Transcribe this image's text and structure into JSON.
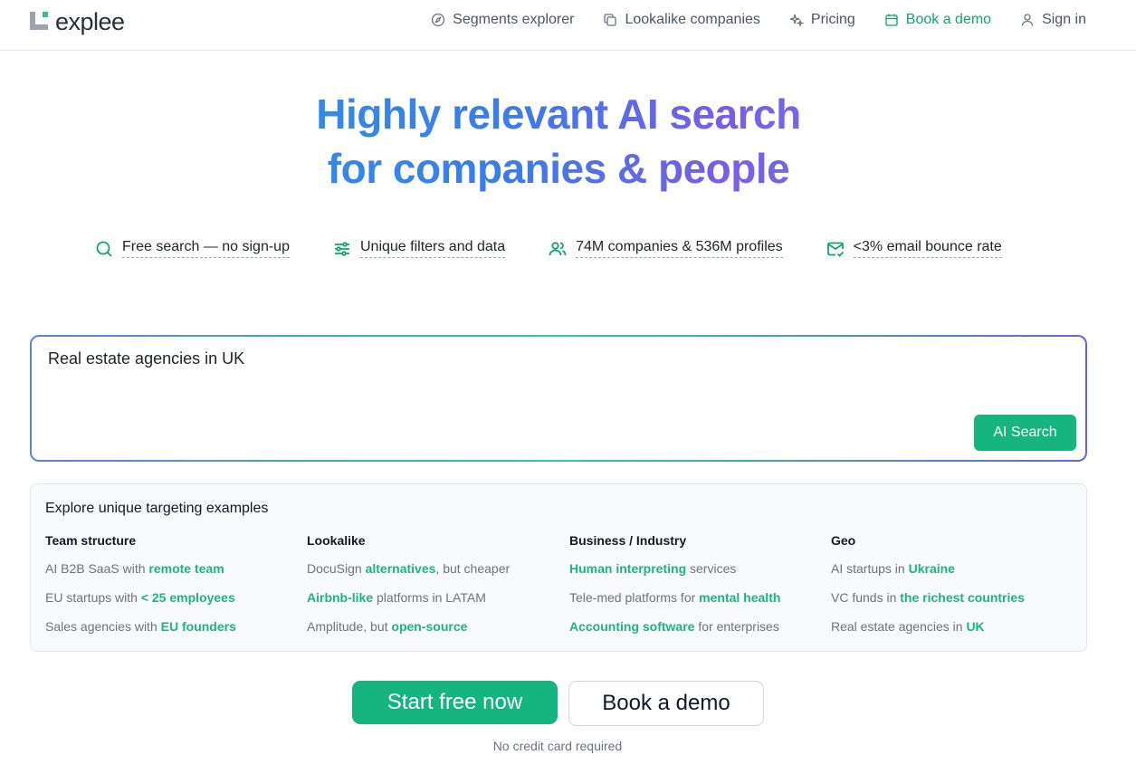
{
  "brand": {
    "name": "explee"
  },
  "nav": {
    "segments": "Segments explorer",
    "lookalike": "Lookalike companies",
    "pricing": "Pricing",
    "book_demo": "Book a demo",
    "sign_in": "Sign in"
  },
  "hero": {
    "line1": "Highly relevant AI search",
    "line2": "for companies & people"
  },
  "features": [
    {
      "text": "Free search — no sign-up",
      "icon": "search-icon"
    },
    {
      "text": "Unique filters and data",
      "icon": "sliders-icon"
    },
    {
      "text": "74M companies & 536M profiles",
      "icon": "users-icon"
    },
    {
      "text": "<3% email bounce rate",
      "icon": "mail-check-icon"
    }
  ],
  "search": {
    "value": "Real estate agencies in UK",
    "button": "AI Search"
  },
  "examples": {
    "title": "Explore unique targeting examples",
    "columns": [
      {
        "heading": "Team structure",
        "items": [
          {
            "pre": "AI B2B SaaS with ",
            "hl": "remote team",
            "post": ""
          },
          {
            "pre": "EU startups with ",
            "hl": "< 25 employees",
            "post": ""
          },
          {
            "pre": "Sales agencies with ",
            "hl": "EU founders",
            "post": ""
          }
        ]
      },
      {
        "heading": "Lookalike",
        "items": [
          {
            "pre": "DocuSign ",
            "hl": "alternatives",
            "post": ", but cheaper"
          },
          {
            "pre": "",
            "hl": "Airbnb-like",
            "post": " platforms in LATAM"
          },
          {
            "pre": "Amplitude, but ",
            "hl": "open-source",
            "post": ""
          }
        ]
      },
      {
        "heading": "Business / Industry",
        "items": [
          {
            "pre": "",
            "hl": "Human interpreting",
            "post": " services"
          },
          {
            "pre": "Tele-med platforms for ",
            "hl": "mental health",
            "post": ""
          },
          {
            "pre": "",
            "hl": "Accounting software",
            "post": " for enterprises"
          }
        ]
      },
      {
        "heading": "Geo",
        "items": [
          {
            "pre": "AI startups in ",
            "hl": "Ukraine",
            "post": ""
          },
          {
            "pre": "VC funds in ",
            "hl": "the richest countries",
            "post": ""
          },
          {
            "pre": "Real estate agencies in ",
            "hl": "UK",
            "post": ""
          }
        ]
      }
    ]
  },
  "cta": {
    "primary": "Start free now",
    "secondary": "Book a demo",
    "note": "No credit card required"
  },
  "colors": {
    "accent": "#16b47e",
    "highlight": "#20b08a"
  }
}
